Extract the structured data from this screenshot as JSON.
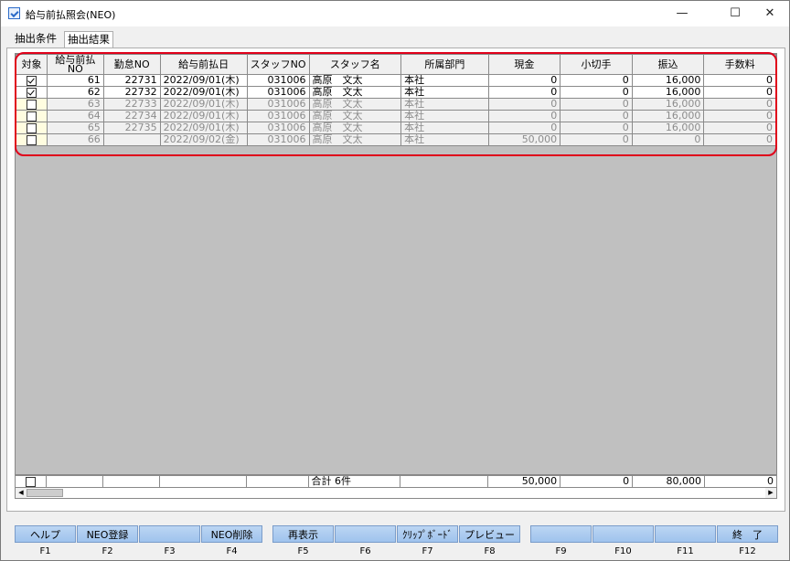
{
  "window": {
    "title": "給与前払照会(NEO)",
    "min": "—",
    "max": "☐",
    "close": "✕"
  },
  "tabs": [
    {
      "label": "抽出条件"
    },
    {
      "label": "抽出結果"
    }
  ],
  "grid": {
    "headers": [
      "対象",
      "給与前払NO",
      "勤怠NO",
      "給与前払日",
      "スタッフNO",
      "スタッフ名",
      "所属部門",
      "現金",
      "小切手",
      "振込",
      "手数料"
    ],
    "header_lines": [
      [
        "対象"
      ],
      [
        "給与前払",
        "NO"
      ],
      [
        "勤怠NO"
      ],
      [
        "給与前払日"
      ],
      [
        "スタッフNO"
      ],
      [
        "スタッフ名"
      ],
      [
        "所属部門"
      ],
      [
        "現金"
      ],
      [
        "小切手"
      ],
      [
        "振込"
      ],
      [
        "手数料"
      ]
    ],
    "rows": [
      {
        "checked": true,
        "active": true,
        "adv_no": "61",
        "attend_no": "22731",
        "date": "2022/09/01(木)",
        "staff_no": "031006",
        "staff_name": "高原　文太",
        "dept": "本社",
        "cash": "0",
        "check": "0",
        "transfer": "16,000",
        "fee": "0"
      },
      {
        "checked": true,
        "active": true,
        "adv_no": "62",
        "attend_no": "22732",
        "date": "2022/09/01(木)",
        "staff_no": "031006",
        "staff_name": "高原　文太",
        "dept": "本社",
        "cash": "0",
        "check": "0",
        "transfer": "16,000",
        "fee": "0"
      },
      {
        "checked": false,
        "active": false,
        "adv_no": "63",
        "attend_no": "22733",
        "date": "2022/09/01(木)",
        "staff_no": "031006",
        "staff_name": "高原　文太",
        "dept": "本社",
        "cash": "0",
        "check": "0",
        "transfer": "16,000",
        "fee": "0"
      },
      {
        "checked": false,
        "active": false,
        "adv_no": "64",
        "attend_no": "22734",
        "date": "2022/09/01(木)",
        "staff_no": "031006",
        "staff_name": "高原　文太",
        "dept": "本社",
        "cash": "0",
        "check": "0",
        "transfer": "16,000",
        "fee": "0"
      },
      {
        "checked": false,
        "active": false,
        "adv_no": "65",
        "attend_no": "22735",
        "date": "2022/09/01(木)",
        "staff_no": "031006",
        "staff_name": "高原　文太",
        "dept": "本社",
        "cash": "0",
        "check": "0",
        "transfer": "16,000",
        "fee": "0"
      },
      {
        "checked": false,
        "active": false,
        "adv_no": "66",
        "attend_no": "",
        "date": "2022/09/02(金)",
        "staff_no": "031006",
        "staff_name": "高原　文太",
        "dept": "本社",
        "cash": "50,000",
        "check": "0",
        "transfer": "0",
        "fee": "0"
      }
    ],
    "totals": {
      "label": "合計 6件",
      "cash": "50,000",
      "check": "0",
      "transfer": "80,000",
      "fee": "0"
    }
  },
  "fkeys": [
    {
      "key": "F1",
      "label": "ヘルプ"
    },
    {
      "key": "F2",
      "label": "NEO登録"
    },
    {
      "key": "F3",
      "label": ""
    },
    {
      "key": "F4",
      "label": "NEO削除"
    },
    {
      "key": "F5",
      "label": "再表示"
    },
    {
      "key": "F6",
      "label": ""
    },
    {
      "key": "F7",
      "label": "ｸﾘｯﾌﾟﾎﾞｰﾄﾞ"
    },
    {
      "key": "F8",
      "label": "プレビュー"
    },
    {
      "key": "F9",
      "label": ""
    },
    {
      "key": "F10",
      "label": ""
    },
    {
      "key": "F11",
      "label": ""
    },
    {
      "key": "F12",
      "label": "終　了"
    }
  ],
  "colors": {
    "highlight": "#e0001a",
    "fkey": "#a9caef",
    "grid_bg": "#c0c0c0"
  }
}
